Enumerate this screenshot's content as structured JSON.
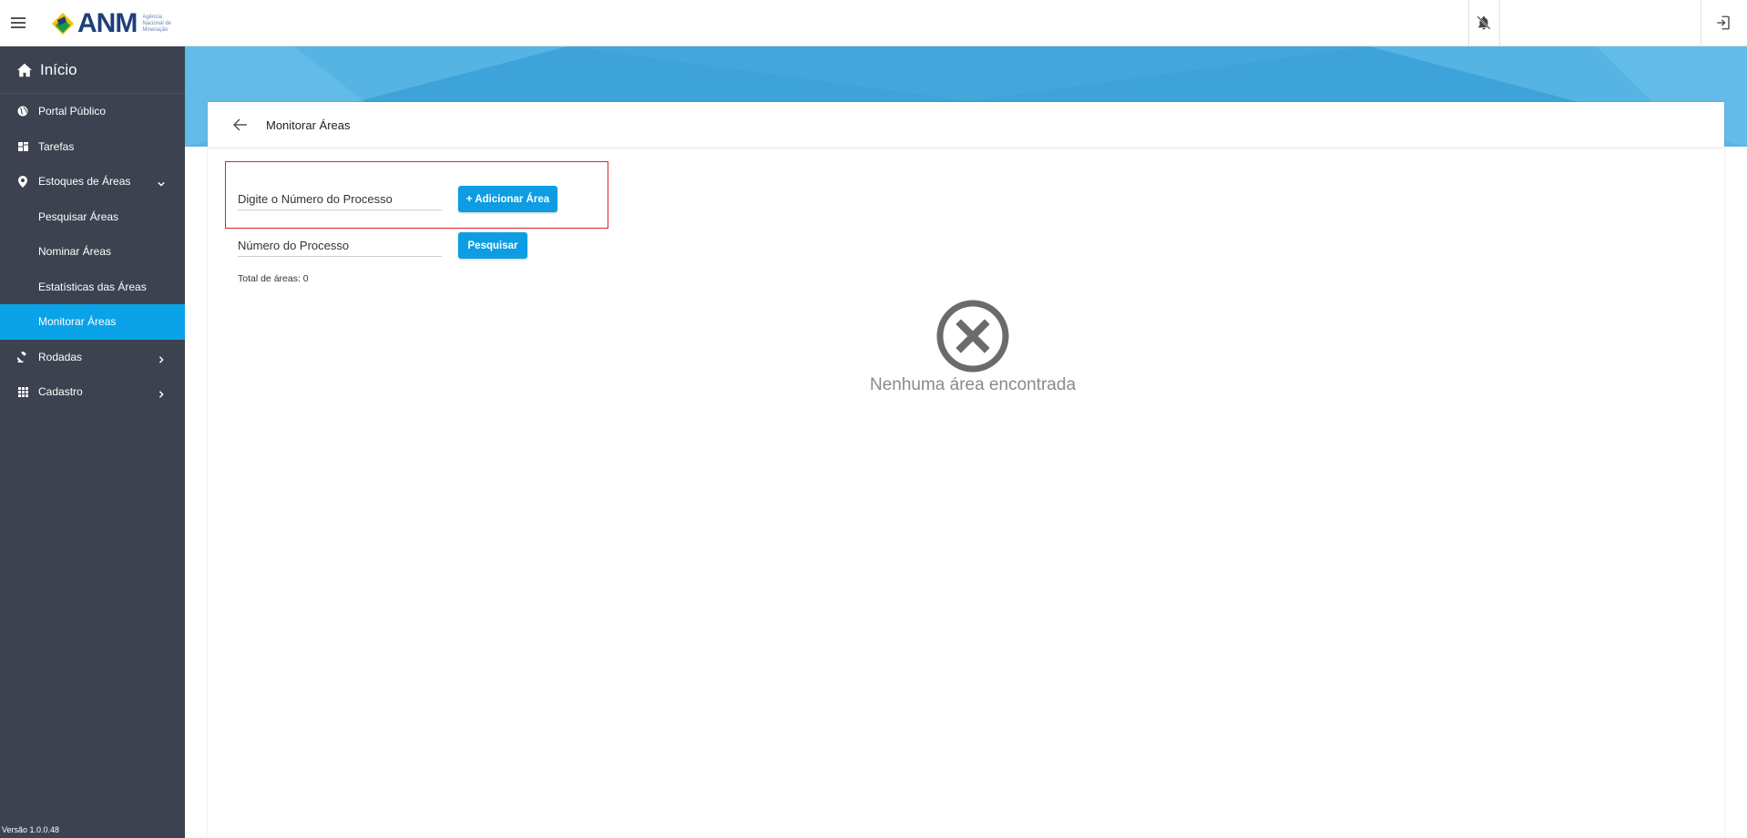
{
  "header": {
    "logo_text": "ANM",
    "logo_subtitle": "Agência Nacional de Mineração",
    "menu_icon": "hamburger-icon",
    "notification_icon": "bell-off-icon",
    "logout_icon": "logout-icon"
  },
  "sidebar": {
    "home_label": "Início",
    "items": [
      {
        "label": "Portal Público",
        "icon": "globe-icon"
      },
      {
        "label": "Tarefas",
        "icon": "dashboard-icon"
      },
      {
        "label": "Estoques de Áreas",
        "icon": "location-pin-icon",
        "expanded": true
      },
      {
        "label": "Rodadas",
        "icon": "gavel-icon"
      },
      {
        "label": "Cadastro",
        "icon": "grid-icon"
      }
    ],
    "subitems": [
      {
        "label": "Pesquisar Áreas"
      },
      {
        "label": "Nominar Áreas"
      },
      {
        "label": "Estatísticas das Áreas"
      },
      {
        "label": "Monitorar Áreas",
        "active": true
      }
    ],
    "version": "Versão 1.0.0.48",
    "active_color": "#0aa3e8",
    "background_color": "#3c4250"
  },
  "page": {
    "title": "Monitorar Áreas",
    "add_form": {
      "placeholder": "Digite o Número do Processo",
      "button_label": "+ Adicionar Área"
    },
    "search_form": {
      "placeholder": "Número do Processo",
      "button_label": "Pesquisar"
    },
    "total_label": "Total de áreas: 0",
    "empty_message": "Nenhuma área encontrada",
    "accent_color": "#0e9de3",
    "highlight_color": "#e1202a"
  }
}
